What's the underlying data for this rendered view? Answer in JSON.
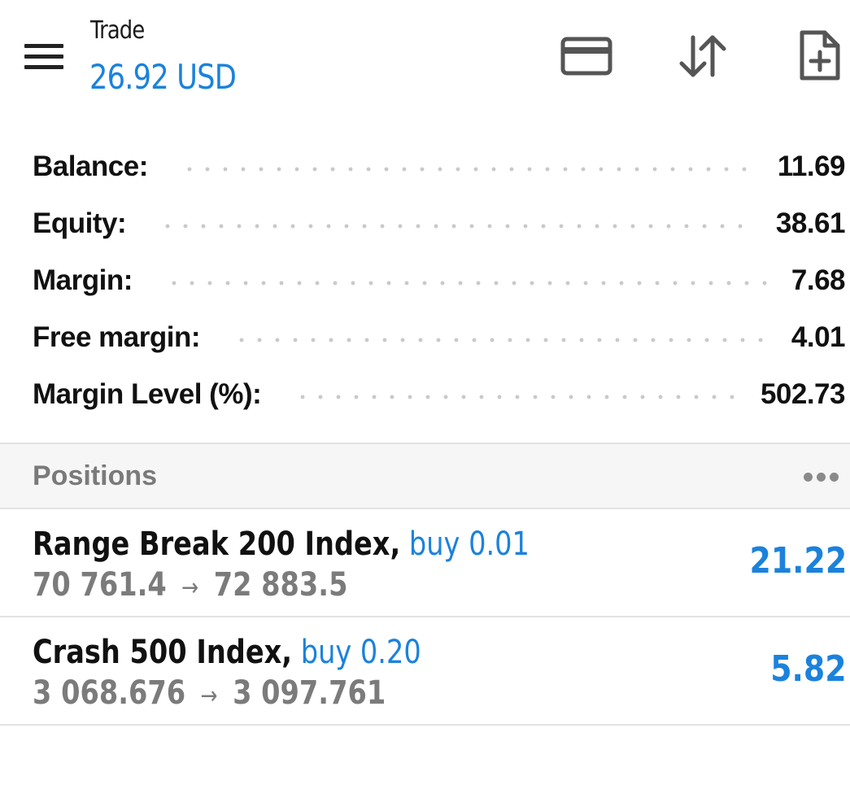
{
  "header": {
    "title": "Trade",
    "subtitle": "26.92 USD",
    "icons": [
      "menu-icon",
      "credit-card-icon",
      "sort-icon",
      "new-order-icon"
    ]
  },
  "summary": {
    "rows": [
      {
        "label": "Balance:",
        "value": "11.69"
      },
      {
        "label": "Equity:",
        "value": "38.61"
      },
      {
        "label": "Margin:",
        "value": "7.68"
      },
      {
        "label": "Free margin:",
        "value": "4.01"
      },
      {
        "label": "Margin Level (%):",
        "value": "502.73"
      }
    ]
  },
  "positions": {
    "title": "Positions",
    "more_icon": "more-horizontal-icon",
    "arrow": "→",
    "items": [
      {
        "symbol": "Range Break 200 Index,",
        "type": "buy 0.01",
        "open_price": "70 761.4",
        "current_price": "72 883.5",
        "profit": "21.22"
      },
      {
        "symbol": "Crash 500 Index,",
        "type": "buy 0.20",
        "open_price": "3 068.676",
        "current_price": "3 097.761",
        "profit": "5.82"
      }
    ]
  },
  "colors": {
    "accent": "#1b82dc",
    "text": "#111111",
    "muted": "#7b7b7b",
    "section_bg": "#f6f6f6",
    "divider": "#e3e3e3"
  }
}
